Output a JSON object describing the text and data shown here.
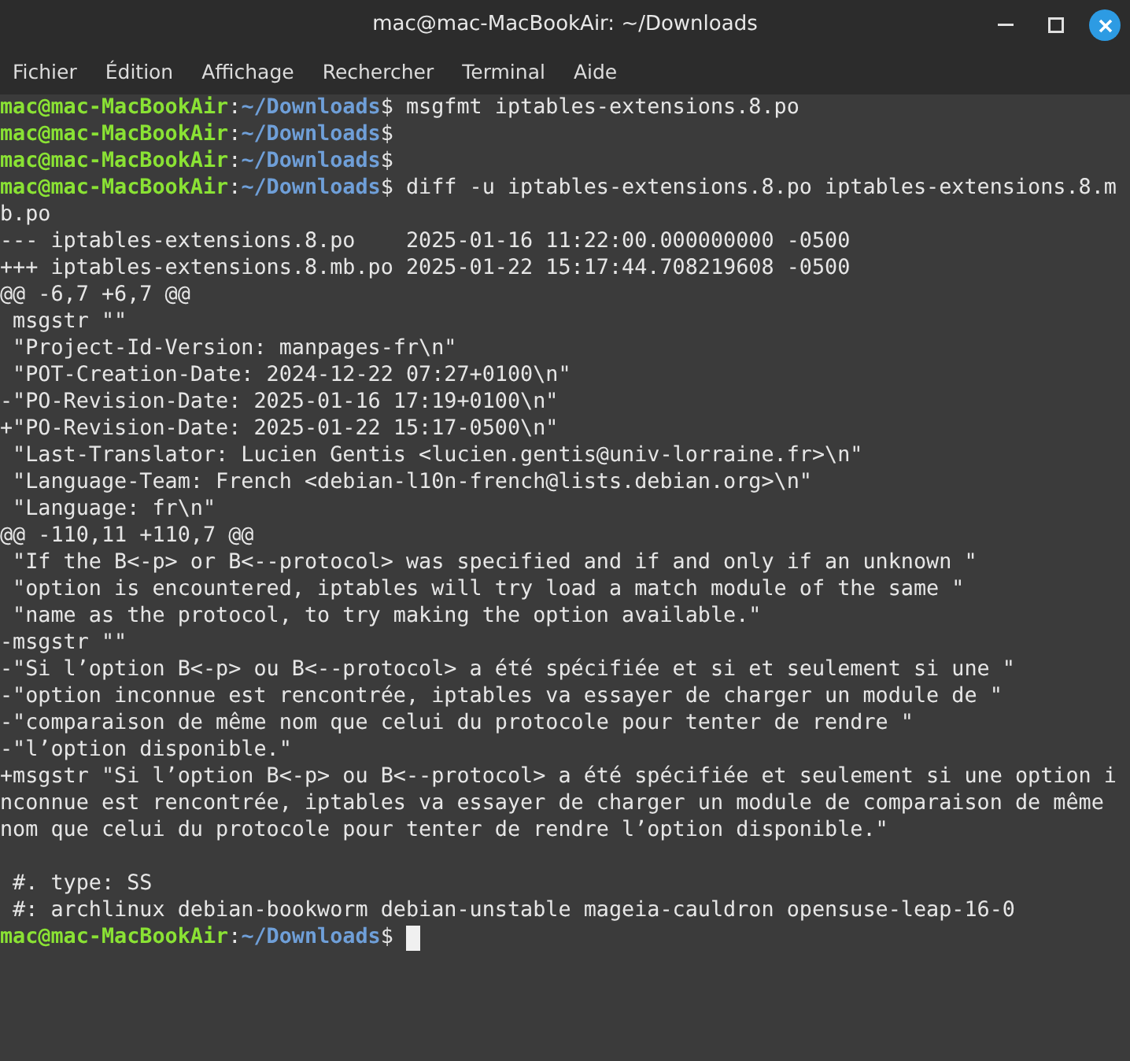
{
  "window": {
    "title": "mac@mac-MacBookAir: ~/Downloads"
  },
  "menu": [
    {
      "label": "Fichier"
    },
    {
      "label": "Édition"
    },
    {
      "label": "Affichage"
    },
    {
      "label": "Rechercher"
    },
    {
      "label": "Terminal"
    },
    {
      "label": "Aide"
    }
  ],
  "lines": [
    {
      "kind": "prompt",
      "user_host": "mac@mac-MacBookAir",
      "separator": ":",
      "path": "~/Downloads",
      "symbol": "$",
      "command": " msgfmt iptables-extensions.8.po"
    },
    {
      "kind": "prompt",
      "user_host": "mac@mac-MacBookAir",
      "separator": ":",
      "path": "~/Downloads",
      "symbol": "$"
    },
    {
      "kind": "prompt",
      "user_host": "mac@mac-MacBookAir",
      "separator": ":",
      "path": "~/Downloads",
      "symbol": "$"
    },
    {
      "kind": "prompt",
      "user_host": "mac@mac-MacBookAir",
      "separator": ":",
      "path": "~/Downloads",
      "symbol": "$",
      "command": " diff -u iptables-extensions.8.po iptables-extensions.8.m"
    },
    {
      "kind": "text",
      "text": "b.po"
    },
    {
      "kind": "text",
      "text": "--- iptables-extensions.8.po    2025-01-16 11:22:00.000000000 -0500"
    },
    {
      "kind": "text",
      "text": "+++ iptables-extensions.8.mb.po 2025-01-22 15:17:44.708219608 -0500"
    },
    {
      "kind": "text",
      "text": "@@ -6,7 +6,7 @@"
    },
    {
      "kind": "text",
      "text": " msgstr \"\""
    },
    {
      "kind": "text",
      "text": " \"Project-Id-Version: manpages-fr\\n\""
    },
    {
      "kind": "text",
      "text": " \"POT-Creation-Date: 2024-12-22 07:27+0100\\n\""
    },
    {
      "kind": "text",
      "text": "-\"PO-Revision-Date: 2025-01-16 17:19+0100\\n\""
    },
    {
      "kind": "text",
      "text": "+\"PO-Revision-Date: 2025-01-22 15:17-0500\\n\""
    },
    {
      "kind": "text",
      "text": " \"Last-Translator: Lucien Gentis <lucien.gentis@univ-lorraine.fr>\\n\""
    },
    {
      "kind": "text",
      "text": " \"Language-Team: French <debian-l10n-french@lists.debian.org>\\n\""
    },
    {
      "kind": "text",
      "text": " \"Language: fr\\n\""
    },
    {
      "kind": "text",
      "text": "@@ -110,11 +110,7 @@"
    },
    {
      "kind": "text",
      "text": " \"If the B<-p> or B<--protocol> was specified and if and only if an unknown \""
    },
    {
      "kind": "text",
      "text": " \"option is encountered, iptables will try load a match module of the same \""
    },
    {
      "kind": "text",
      "text": " \"name as the protocol, to try making the option available.\""
    },
    {
      "kind": "text",
      "text": "-msgstr \"\""
    },
    {
      "kind": "text",
      "text": "-\"Si l’option B<-p> ou B<--protocol> a été spécifiée et si et seulement si une \""
    },
    {
      "kind": "text",
      "text": "-\"option inconnue est rencontrée, iptables va essayer de charger un module de \""
    },
    {
      "kind": "text",
      "text": "-\"comparaison de même nom que celui du protocole pour tenter de rendre \""
    },
    {
      "kind": "text",
      "text": "-\"l’option disponible.\""
    },
    {
      "kind": "text",
      "text": "+msgstr \"Si l’option B<-p> ou B<--protocol> a été spécifiée et seulement si une option i"
    },
    {
      "kind": "text",
      "text": "nconnue est rencontrée, iptables va essayer de charger un module de comparaison de même"
    },
    {
      "kind": "text",
      "text": "nom que celui du protocole pour tenter de rendre l’option disponible.\""
    },
    {
      "kind": "blank"
    },
    {
      "kind": "text",
      "text": " #. type: SS"
    },
    {
      "kind": "text",
      "text": " #: archlinux debian-bookworm debian-unstable mageia-cauldron opensuse-leap-16-0"
    },
    {
      "kind": "prompt",
      "user_host": "mac@mac-MacBookAir",
      "separator": ":",
      "path": "~/Downloads",
      "symbol": "$",
      "cursor": true
    }
  ]
}
